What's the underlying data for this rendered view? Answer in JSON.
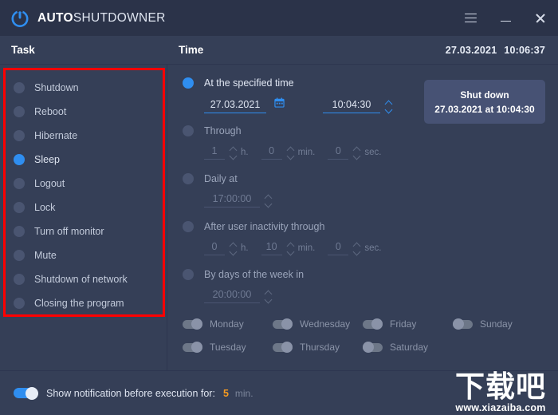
{
  "titlebar": {
    "logo_icon": "power-icon",
    "title_bold": "AUTO",
    "title_light": "SHUTDOWNER",
    "menu_icon": "hamburger-menu-icon",
    "minimize_icon": "minimize-icon",
    "close_icon": "close-icon"
  },
  "task_panel": {
    "header": "Task",
    "items": [
      {
        "label": "Shutdown",
        "selected": false
      },
      {
        "label": "Reboot",
        "selected": false
      },
      {
        "label": "Hibernate",
        "selected": false
      },
      {
        "label": "Sleep",
        "selected": true
      },
      {
        "label": "Logout",
        "selected": false
      },
      {
        "label": "Lock",
        "selected": false
      },
      {
        "label": "Turn off monitor",
        "selected": false
      },
      {
        "label": "Mute",
        "selected": false
      },
      {
        "label": "Shutdown of network",
        "selected": false
      },
      {
        "label": "Closing the program",
        "selected": false
      }
    ],
    "annotation_color": "#ff0000"
  },
  "time_panel": {
    "header": "Time",
    "current_date": "27.03.2021",
    "current_time": "10:06:37",
    "options": [
      {
        "label": "At the specified time",
        "selected": true,
        "date": "27.03.2021",
        "time": "10:04:30",
        "calendar_icon": "calendar-icon"
      },
      {
        "label": "Through",
        "selected": false,
        "hours": "1",
        "hours_unit": "h.",
        "minutes": "0",
        "minutes_unit": "min.",
        "seconds": "0",
        "seconds_unit": "sec."
      },
      {
        "label": "Daily at",
        "selected": false,
        "time": "17:00:00"
      },
      {
        "label": "After user inactivity through",
        "selected": false,
        "hours": "0",
        "hours_unit": "h.",
        "minutes": "10",
        "minutes_unit": "min.",
        "seconds": "0",
        "seconds_unit": "sec."
      },
      {
        "label": "By days of the week in",
        "selected": false,
        "time": "20:00:00"
      }
    ],
    "shutdown_button": {
      "line1": "Shut down",
      "line2": "27.03.2021 at 10:04:30"
    },
    "weekdays": [
      {
        "label": "Monday",
        "on": true
      },
      {
        "label": "Wednesday",
        "on": true
      },
      {
        "label": "Friday",
        "on": true
      },
      {
        "label": "Sunday",
        "on": false
      },
      {
        "label": "Tuesday",
        "on": true
      },
      {
        "label": "Thursday",
        "on": true
      },
      {
        "label": "Saturday",
        "on": false
      }
    ]
  },
  "bottom_bar": {
    "toggle_on": true,
    "label": "Show notification before execution for:",
    "value": "5",
    "unit": "min.",
    "accent_color": "#f59a21"
  },
  "watermark": {
    "text_cn": "下载吧",
    "url": "www.xiazaiba.com"
  },
  "colors": {
    "background": "#353f57",
    "titlebar": "#2b3349",
    "accent_blue": "#2f8ef0",
    "button": "#475274",
    "annotation_red": "#ff0000",
    "orange": "#f59a21"
  }
}
